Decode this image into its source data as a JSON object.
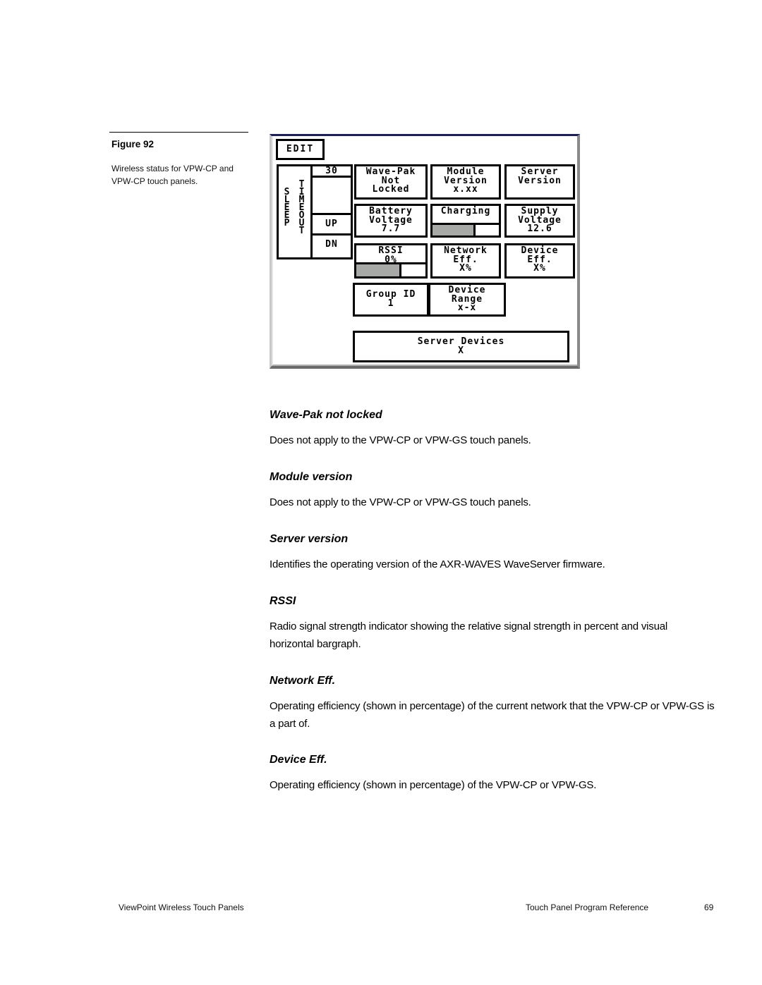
{
  "figure": {
    "title": "Figure 92",
    "caption": "Wireless status for VPW-CP and VPW-CP touch panels."
  },
  "panel": {
    "edit_label": "EDIT",
    "sleep_label": [
      "S",
      "L",
      "E",
      "E",
      "P"
    ],
    "timeout_label": [
      "T",
      "I",
      "M",
      "E",
      "O",
      "U",
      "T"
    ],
    "timeout_value": "30",
    "up_label": "UP",
    "dn_label": "DN",
    "wavepak": [
      "Wave-Pak",
      "Not",
      "Locked"
    ],
    "module_version": [
      "Module",
      "Version",
      "x.xx"
    ],
    "server_version": [
      "Server",
      "Version"
    ],
    "battery_voltage": [
      "Battery",
      "Voltage",
      "7.7"
    ],
    "charging": {
      "label": "Charging",
      "level_percent": 65
    },
    "supply_voltage": [
      "Supply",
      "Voltage",
      "12.6"
    ],
    "rssi": {
      "lines": [
        "RSSI",
        "0%"
      ],
      "level_percent": 65
    },
    "network_eff": [
      "Network",
      "Eff.",
      "X%"
    ],
    "device_eff": [
      "Device",
      "Eff.",
      "X%"
    ],
    "group_id": [
      "Group ID",
      "1"
    ],
    "device_range": [
      "Device",
      "Range",
      "x-x"
    ],
    "server_devices": [
      "Server Devices",
      "X"
    ],
    "colors": {
      "bar_fill": "#a7a9a6",
      "title_bar": "#1a1f5a"
    }
  },
  "sections": [
    {
      "heading": "Wave-Pak not locked",
      "body": "Does not apply to the VPW-CP or VPW-GS touch panels."
    },
    {
      "heading": "Module version",
      "body": "Does not apply to the VPW-CP or VPW-GS touch panels."
    },
    {
      "heading": "Server version",
      "body": "Identifies the operating version of the AXR-WAVES WaveServer firmware."
    },
    {
      "heading": "RSSI",
      "body": "Radio signal strength indicator showing the relative signal strength in percent and visual horizontal bargraph."
    },
    {
      "heading": "Network Eff.",
      "body": "Operating efficiency (shown in percentage) of the current network that the VPW-CP or VPW-GS is a part of."
    },
    {
      "heading": "Device Eff.",
      "body": "Operating efficiency (shown in percentage) of the VPW-CP or VPW-GS."
    }
  ],
  "footer": {
    "left": "ViewPoint Wireless Touch Panels",
    "center": "Touch Panel Program Reference",
    "page": "69"
  }
}
